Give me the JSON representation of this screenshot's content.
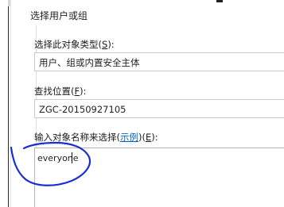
{
  "dialog": {
    "title": "选择用户或组",
    "object_type": {
      "label_prefix": "选择此对象类型(",
      "label_key": "S",
      "label_suffix": "):",
      "value": "用户、组或内置安全主体"
    },
    "location": {
      "label_prefix": "查找位置(",
      "label_key": "F",
      "label_suffix": "):",
      "value": "ZGC-20150927105"
    },
    "object_names": {
      "label_prefix": "输入对象名称来选择(",
      "examples_link": "示例",
      "label_mid": ")(",
      "label_key": "E",
      "label_suffix": "):",
      "value": "everyone"
    }
  },
  "colors": {
    "annotation": "#1a2fd0",
    "link": "#0066cc"
  }
}
